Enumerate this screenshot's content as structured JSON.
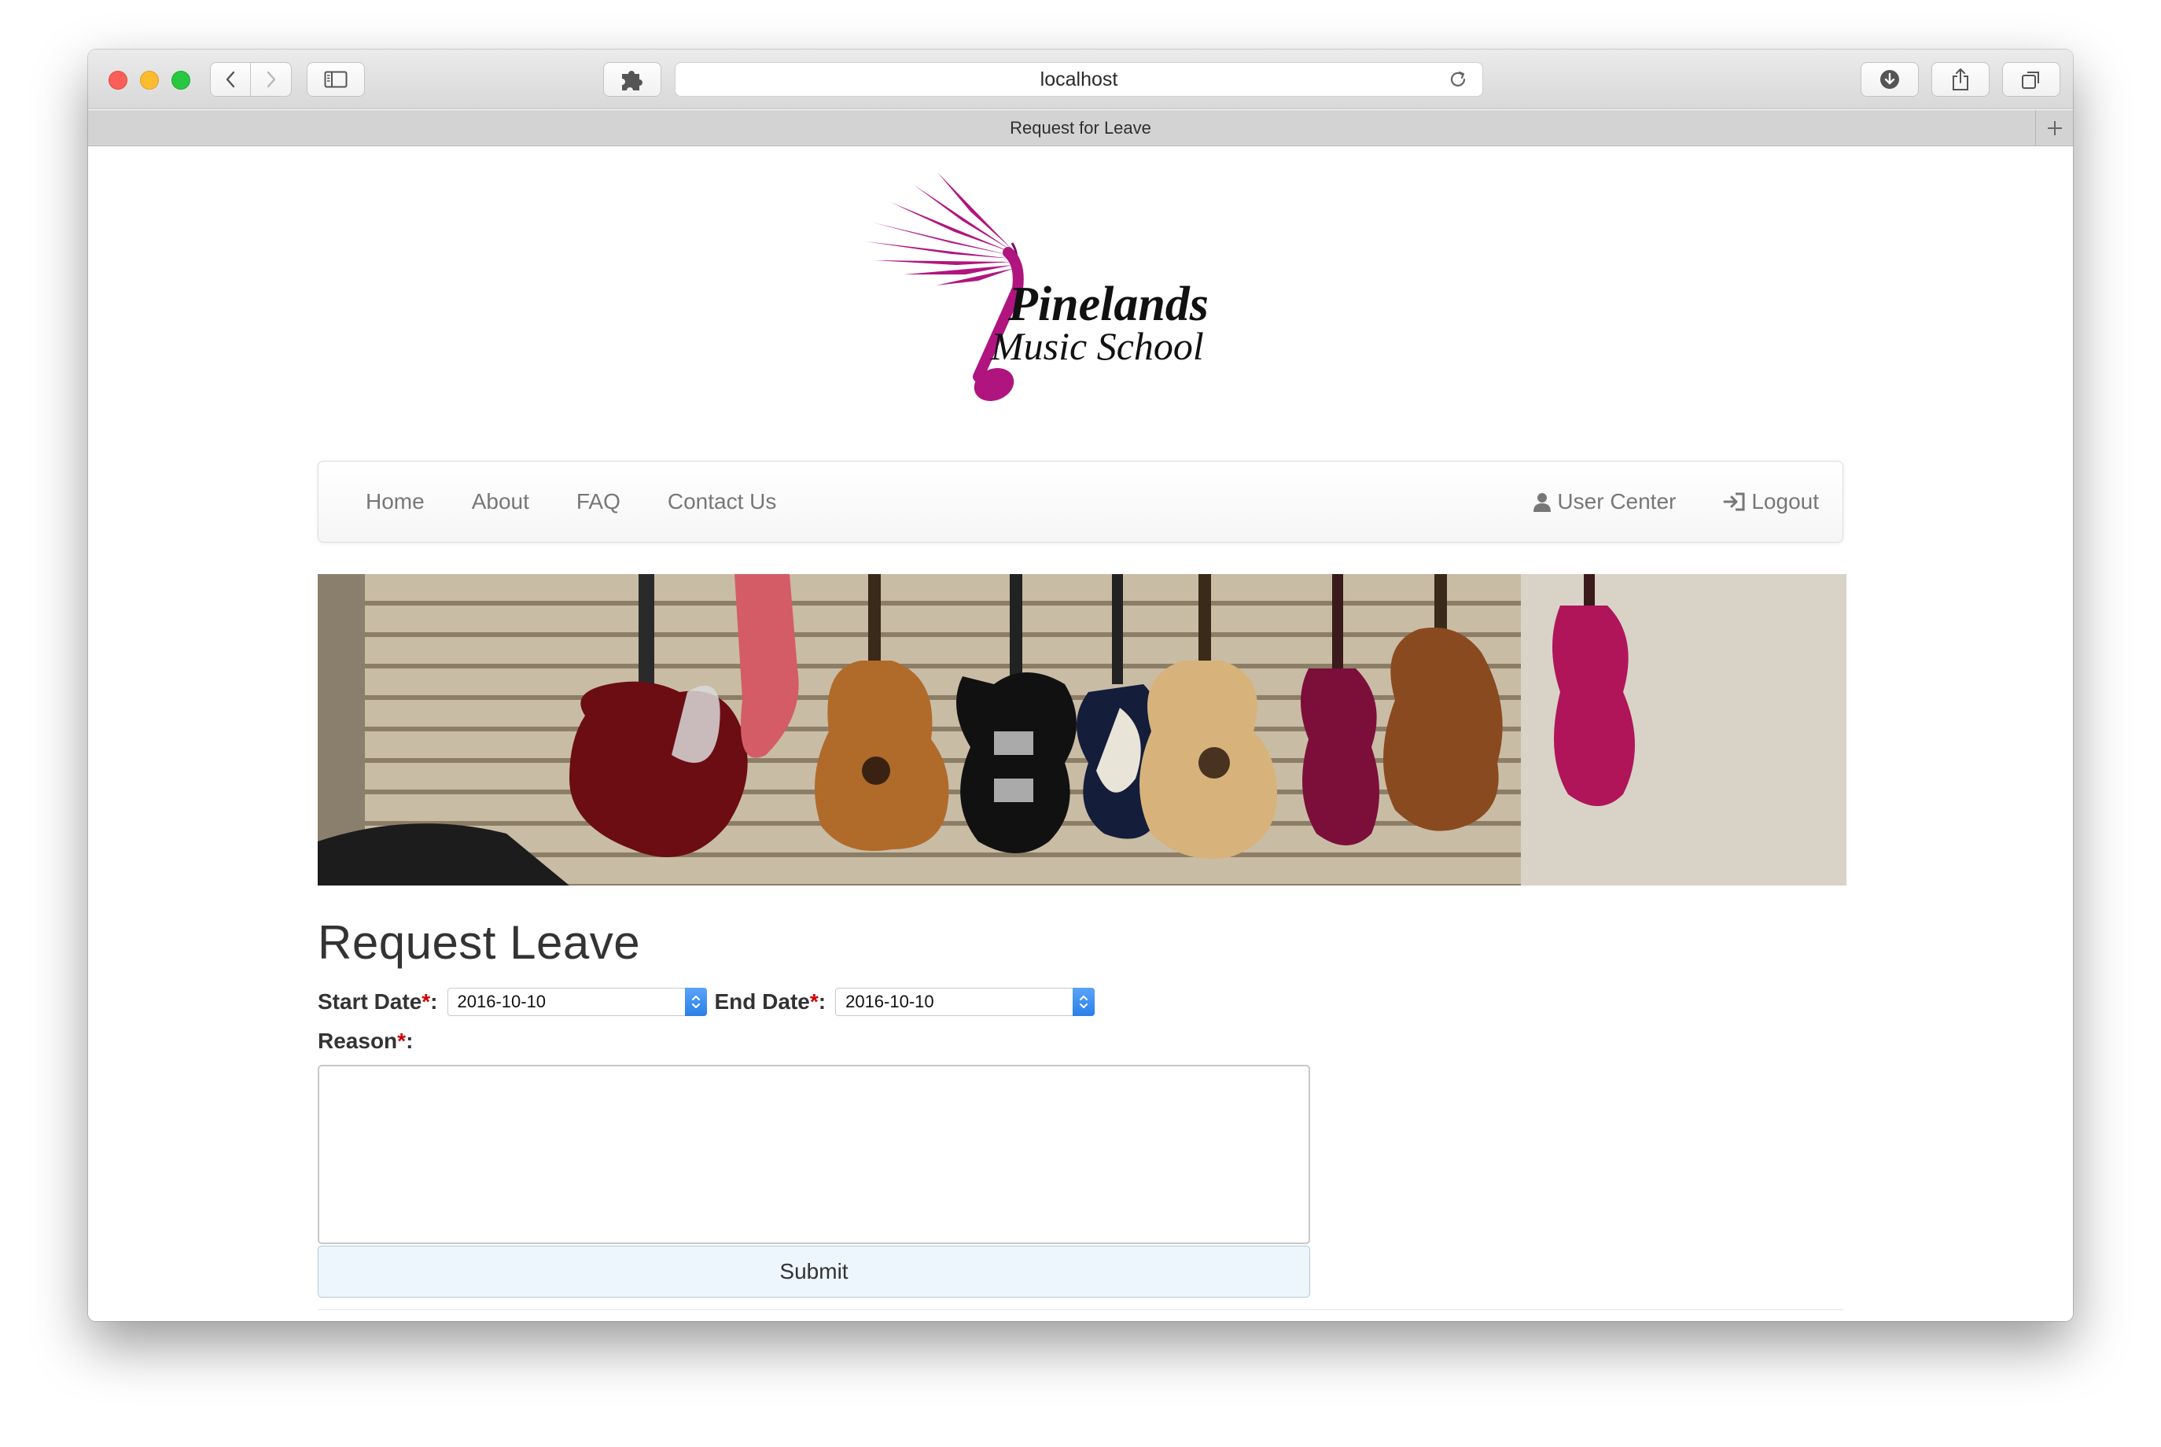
{
  "browser": {
    "url": "localhost",
    "tab_title": "Request for Leave"
  },
  "site": {
    "logo_line1": "Pinelands",
    "logo_line2": "Music School",
    "brand_color": "#b0157f"
  },
  "nav": {
    "left": [
      {
        "label": "Home"
      },
      {
        "label": "About"
      },
      {
        "label": "FAQ"
      },
      {
        "label": "Contact Us"
      }
    ],
    "user_center": "User Center",
    "logout": "Logout"
  },
  "form": {
    "title": "Request Leave",
    "start_date_label": "Start Date",
    "start_date_value": "2016-10-10",
    "end_date_label": "End Date",
    "end_date_value": "2016-10-10",
    "reason_label": "Reason",
    "required_mark": "*",
    "label_suffix": ":",
    "reason_value": "",
    "submit_label": "Submit"
  }
}
